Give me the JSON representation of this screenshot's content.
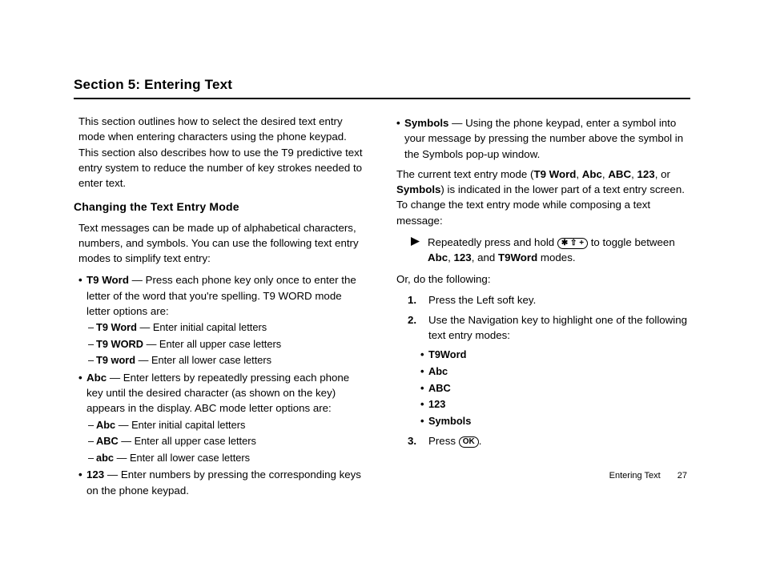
{
  "section_title": "Section 5: Entering Text",
  "intro": "This section outlines how to select the desired text entry mode when entering characters using the phone keypad. This section also describes how to use the T9 predictive text entry system to reduce the number of key strokes needed to enter text.",
  "subhead_changing": "Changing the Text Entry Mode",
  "changing_para": "Text messages can be made up of alphabetical characters, numbers, and symbols. You can use the following text entry modes to simplify text entry:",
  "modes": {
    "t9word": {
      "lead": "T9 Word",
      "desc": " — Press each phone key only once to enter the letter of the word that you're spelling. T9 WORD mode letter options are:",
      "opts": [
        {
          "lead": "T9 Word",
          "desc": " — Enter initial capital letters"
        },
        {
          "lead": "T9 WORD",
          "desc": " — Enter all upper case letters"
        },
        {
          "lead": "T9 word",
          "desc": " — Enter all lower case letters"
        }
      ]
    },
    "abc": {
      "lead": "Abc",
      "desc": " — Enter letters by repeatedly pressing each phone key until the desired character (as shown on the key) appears in the display. ABC mode letter options are:",
      "opts": [
        {
          "lead": "Abc",
          "desc": " — Enter initial capital letters"
        },
        {
          "lead": "ABC",
          "desc": " — Enter all upper case letters"
        },
        {
          "lead": "abc",
          "desc": " — Enter all lower case letters"
        }
      ]
    },
    "n123": {
      "lead": "123",
      "desc": " — Enter numbers by pressing the corresponding keys on the phone keypad."
    },
    "symbols": {
      "lead": "Symbols",
      "desc": " — Using the phone keypad, enter a symbol into your message by pressing the number above the symbol in the Symbols pop-up window."
    }
  },
  "current_mode_sentence": {
    "pre": "The current text entry mode (",
    "m1": "T9 Word",
    "c1": ", ",
    "m2": "Abc",
    "c2": ", ",
    "m3": "ABC",
    "c3": ", ",
    "m4": "123",
    "c4": ", or ",
    "m5": "Symbols",
    "post": ") is indicated in the lower part of a text entry screen. To change the text entry mode while composing a text message:"
  },
  "arrow_step": {
    "pre": "Repeatedly press and hold ",
    "key_label": "✱ ⇧ +",
    "mid": " to toggle between ",
    "m1": "Abc",
    "c1": ", ",
    "m2": "123",
    "c2": ", and ",
    "m3": "T9Word",
    "post": " modes."
  },
  "or_do": "Or, do the following:",
  "steps": {
    "s1_num": "1.",
    "s1": "Press the Left soft key.",
    "s2_num": "2.",
    "s2": "Use the Navigation key to highlight one of the following text entry modes:",
    "s3_num": "3.",
    "s3_pre": "Press ",
    "s3_key": "OK",
    "s3_post": "."
  },
  "sub_modes": [
    "T9Word",
    "Abc",
    "ABC",
    "123",
    "Symbols"
  ],
  "footer": {
    "label": "Entering Text",
    "page": "27"
  }
}
